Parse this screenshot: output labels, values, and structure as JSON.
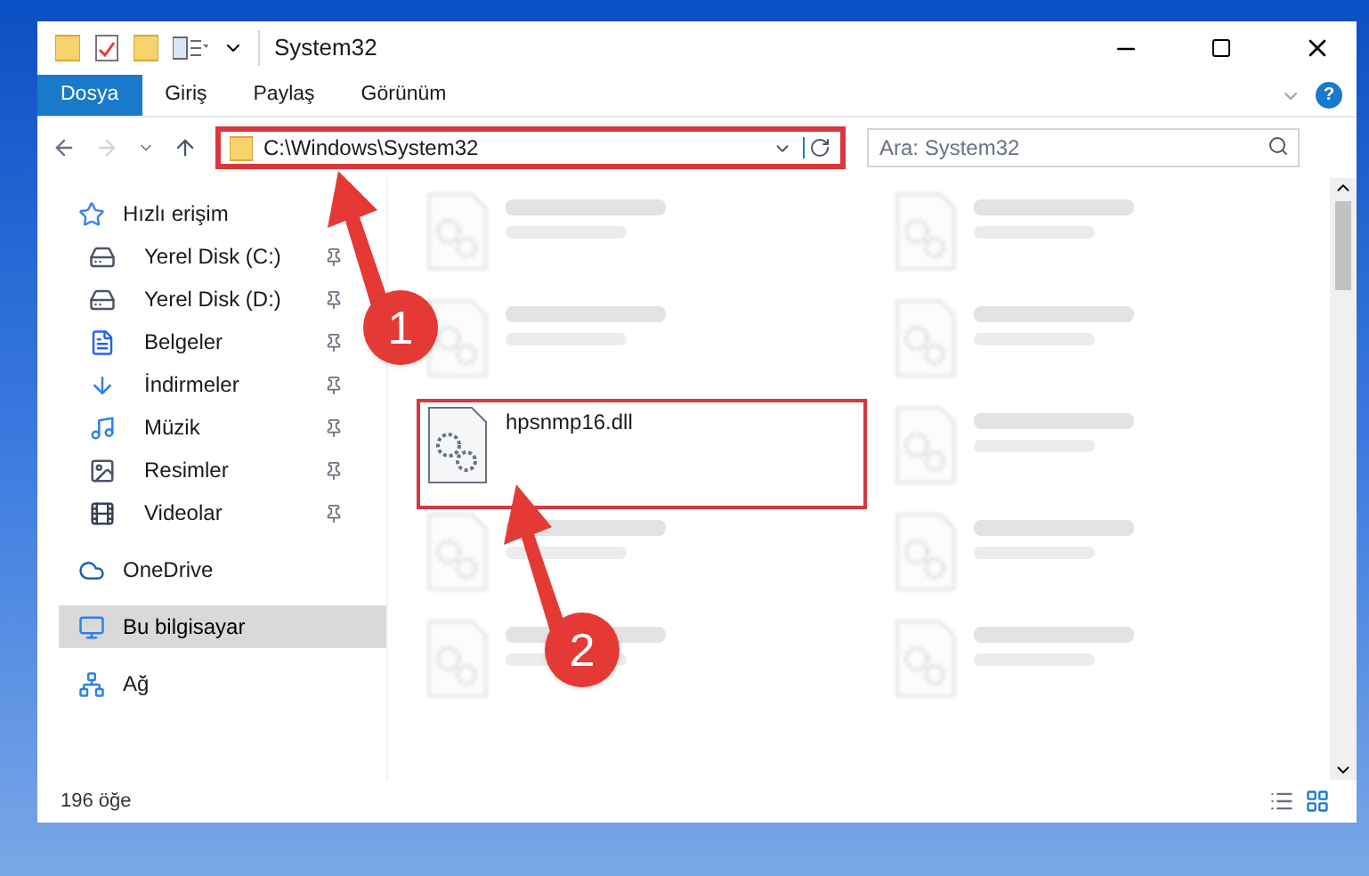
{
  "window": {
    "title": "System32"
  },
  "ribbon_tabs": [
    {
      "label": "Dosya",
      "selected": true
    },
    {
      "label": "Giriş",
      "selected": false
    },
    {
      "label": "Paylaş",
      "selected": false
    },
    {
      "label": "Görünüm",
      "selected": false
    }
  ],
  "help_button": {
    "label": "?"
  },
  "address_bar": {
    "value": "C:\\Windows\\System32",
    "highlighted": true
  },
  "search": {
    "placeholder": "Ara: System32"
  },
  "nav": [
    {
      "label": "Hızlı erişim",
      "kind": "star",
      "selected": false,
      "children": [
        {
          "label": "Yerel Disk (C:)",
          "kind": "drive",
          "pinned": true,
          "selected": false
        },
        {
          "label": "Yerel Disk (D:)",
          "kind": "drive",
          "pinned": true,
          "selected": false
        },
        {
          "label": "Belgeler",
          "kind": "doc",
          "pinned": true,
          "selected": false
        },
        {
          "label": "İndirmeler",
          "kind": "download",
          "pinned": true,
          "selected": false
        },
        {
          "label": "Müzik",
          "kind": "music",
          "pinned": true,
          "selected": false
        },
        {
          "label": "Resimler",
          "kind": "image",
          "pinned": true,
          "selected": false
        },
        {
          "label": "Videolar",
          "kind": "video",
          "pinned": true,
          "selected": false
        }
      ]
    },
    {
      "label": "OneDrive",
      "kind": "cloud",
      "selected": false
    },
    {
      "label": "Bu bilgisayar",
      "kind": "pc",
      "selected": true
    },
    {
      "label": "Ağ",
      "kind": "network",
      "selected": false
    }
  ],
  "files": [
    {
      "blurred": true,
      "highlighted": false
    },
    {
      "blurred": true,
      "highlighted": false
    },
    {
      "blurred": true,
      "highlighted": false
    },
    {
      "blurred": true,
      "highlighted": false
    },
    {
      "name": "hpsnmp16.dll",
      "blurred": false,
      "highlighted": true
    },
    {
      "blurred": true,
      "highlighted": false
    },
    {
      "blurred": true,
      "highlighted": false
    },
    {
      "blurred": true,
      "highlighted": false
    },
    {
      "blurred": true,
      "highlighted": false
    },
    {
      "blurred": true,
      "highlighted": false
    }
  ],
  "status_bar": {
    "count": "196 öğe"
  },
  "annotations": [
    {
      "number": "1"
    },
    {
      "number": "2"
    }
  ]
}
